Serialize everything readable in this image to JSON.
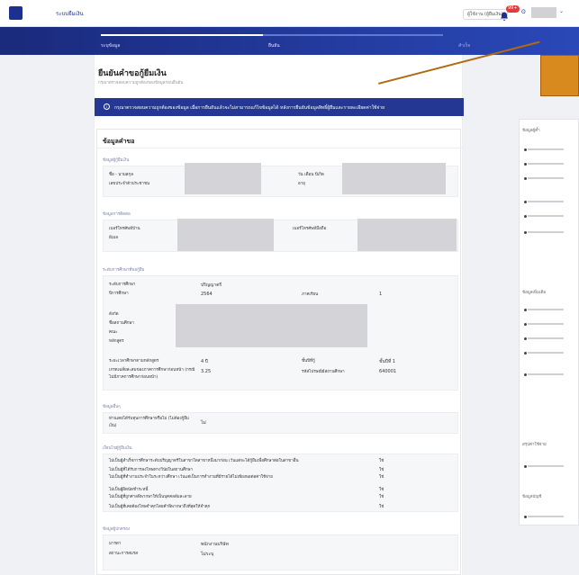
{
  "header": {
    "app_name": "ระบบยืมเงิน",
    "search_label": "ผู้ใช้งาน (ผู้ยืมเงิน)",
    "notif_count": "99+"
  },
  "stepper": {
    "steps": [
      "ระบุข้อมูล",
      "ยืนยัน",
      "สำเร็จ"
    ]
  },
  "page": {
    "title": "ยืนยันคำขอกู้ยืมเงิน",
    "subtitle": "กรุณาตรวจสอบความถูกต้องของข้อมูลก่อนยืนยัน",
    "banner": "กรุณาตรวจสอบความถูกต้องของข้อมูล เมื่อการยืนยันแล้วจะไม่สามารถแก้ไขข้อมูลได้ หลังการยืนยันข้อมูลสิทธิ์ผู้ยืมและรายละเอียดค่าใช้จ่าย"
  },
  "card": {
    "title": "ข้อมูลคำขอ",
    "sections": {
      "borrower": "ข้อมูลผู้กู้ยืมเงิน",
      "contact": "ข้อมูลการติดต่อ",
      "education": "ระดับการศึกษาที่ขอกู้ยืม",
      "other": "ข้อมูลอื่นๆ",
      "conditions": "เงื่อนไขผู้กู้ยืมเงิน",
      "parent": "ข้อมูลผู้ปกครอง"
    },
    "borrower": {
      "name_label": "ชื่อ - นามสกุล",
      "id_label": "เลขประจำตัวประชาชน",
      "dob_label": "วัน เดือน ปีเกิด",
      "age_label": "อายุ"
    },
    "contact": {
      "home_phone_label": "เบอร์โทรศัพท์บ้าน",
      "email_label": "อีเมล",
      "mobile_label": "เบอร์โทรศัพท์มือถือ"
    },
    "education": {
      "level_label": "ระดับการศึกษา",
      "level_value": "ปริญญาตรี",
      "year_label": "ปีการศึกษา",
      "year_value": "2564",
      "term_label": "ภาคเรียน",
      "term_value": "1",
      "school_labels": [
        "สังกัด",
        "ชื่อสถานศึกษา",
        "คณะ",
        "หลักสูตร"
      ],
      "duration_label": "ระยะเวลาศึกษาตามหลักสูตร",
      "duration_value": "4 ปี",
      "class_label": "ชั้นปีที่กู้",
      "class_value": "ชั้นปีที่ 1",
      "gpa_label": "เกรดเฉลี่ยสะสมของภาคการศึกษาก่อนหน้า (กรณีไม่มีภาคการศึกษาก่อนหน้า)",
      "gpa_value": "3.25",
      "postcode_label": "รหัสไปรษณีย์สถานศึกษา",
      "postcode_value": "640001"
    },
    "other": {
      "label": "ท่านเคยได้รับทุนการศึกษาหรือไม่ (ไม่ต้องกู้ยืมเงิน)",
      "value": "ไม่"
    },
    "conditions": [
      {
        "text": "ไม่เป็นผู้สำเร็จการศึกษาระดับปริญญาตรีในสาขาใดสาขาหนึ่งมาก่อน เว้นแต่จะได้กู้ยืมเพื่อศึกษาต่อในสาขาอื่น",
        "answer": "ใช่"
      },
      {
        "text": "ไม่เป็นผู้ที่ได้รับการลงโทษทางวินัยในสถานศึกษา",
        "answer": "ใช่"
      },
      {
        "text": "ไม่เป็นผู้ที่ทำงานประจำในระหว่างศึกษา เว้นแต่เป็นการทำงานที่มีรายได้ไม่เพียงพอต่อค่าใช้จ่าย",
        "answer": "ใช่"
      },
      {
        "text": "ไม่เป็นผู้ผิดนัดชำระหนี้",
        "answer": "ใช่"
      },
      {
        "text": "ไม่เป็นผู้ที่ถูกศาลพิพากษาให้เป็นบุคคลล้มละลาย",
        "answer": "ใช่"
      },
      {
        "text": "ไม่เป็นผู้ที่เคยต้องโทษจำคุกโดยคำพิพากษาถึงที่สุดให้จำคุก",
        "answer": "ใช่"
      }
    ],
    "parent": {
      "relation_label": "มารดา",
      "relation_value": "พนักงานบริษัท",
      "status_label": "สถานะการสมรส",
      "status_value": "ไม่ระบุ"
    }
  },
  "right_panel": {
    "labels": [
      "ข้อมูลผู้ค้ำ",
      "ข้อมูลเพิ่มเติม",
      "สรุปค่าใช้จ่าย",
      "ข้อมูลบัญชี"
    ]
  }
}
